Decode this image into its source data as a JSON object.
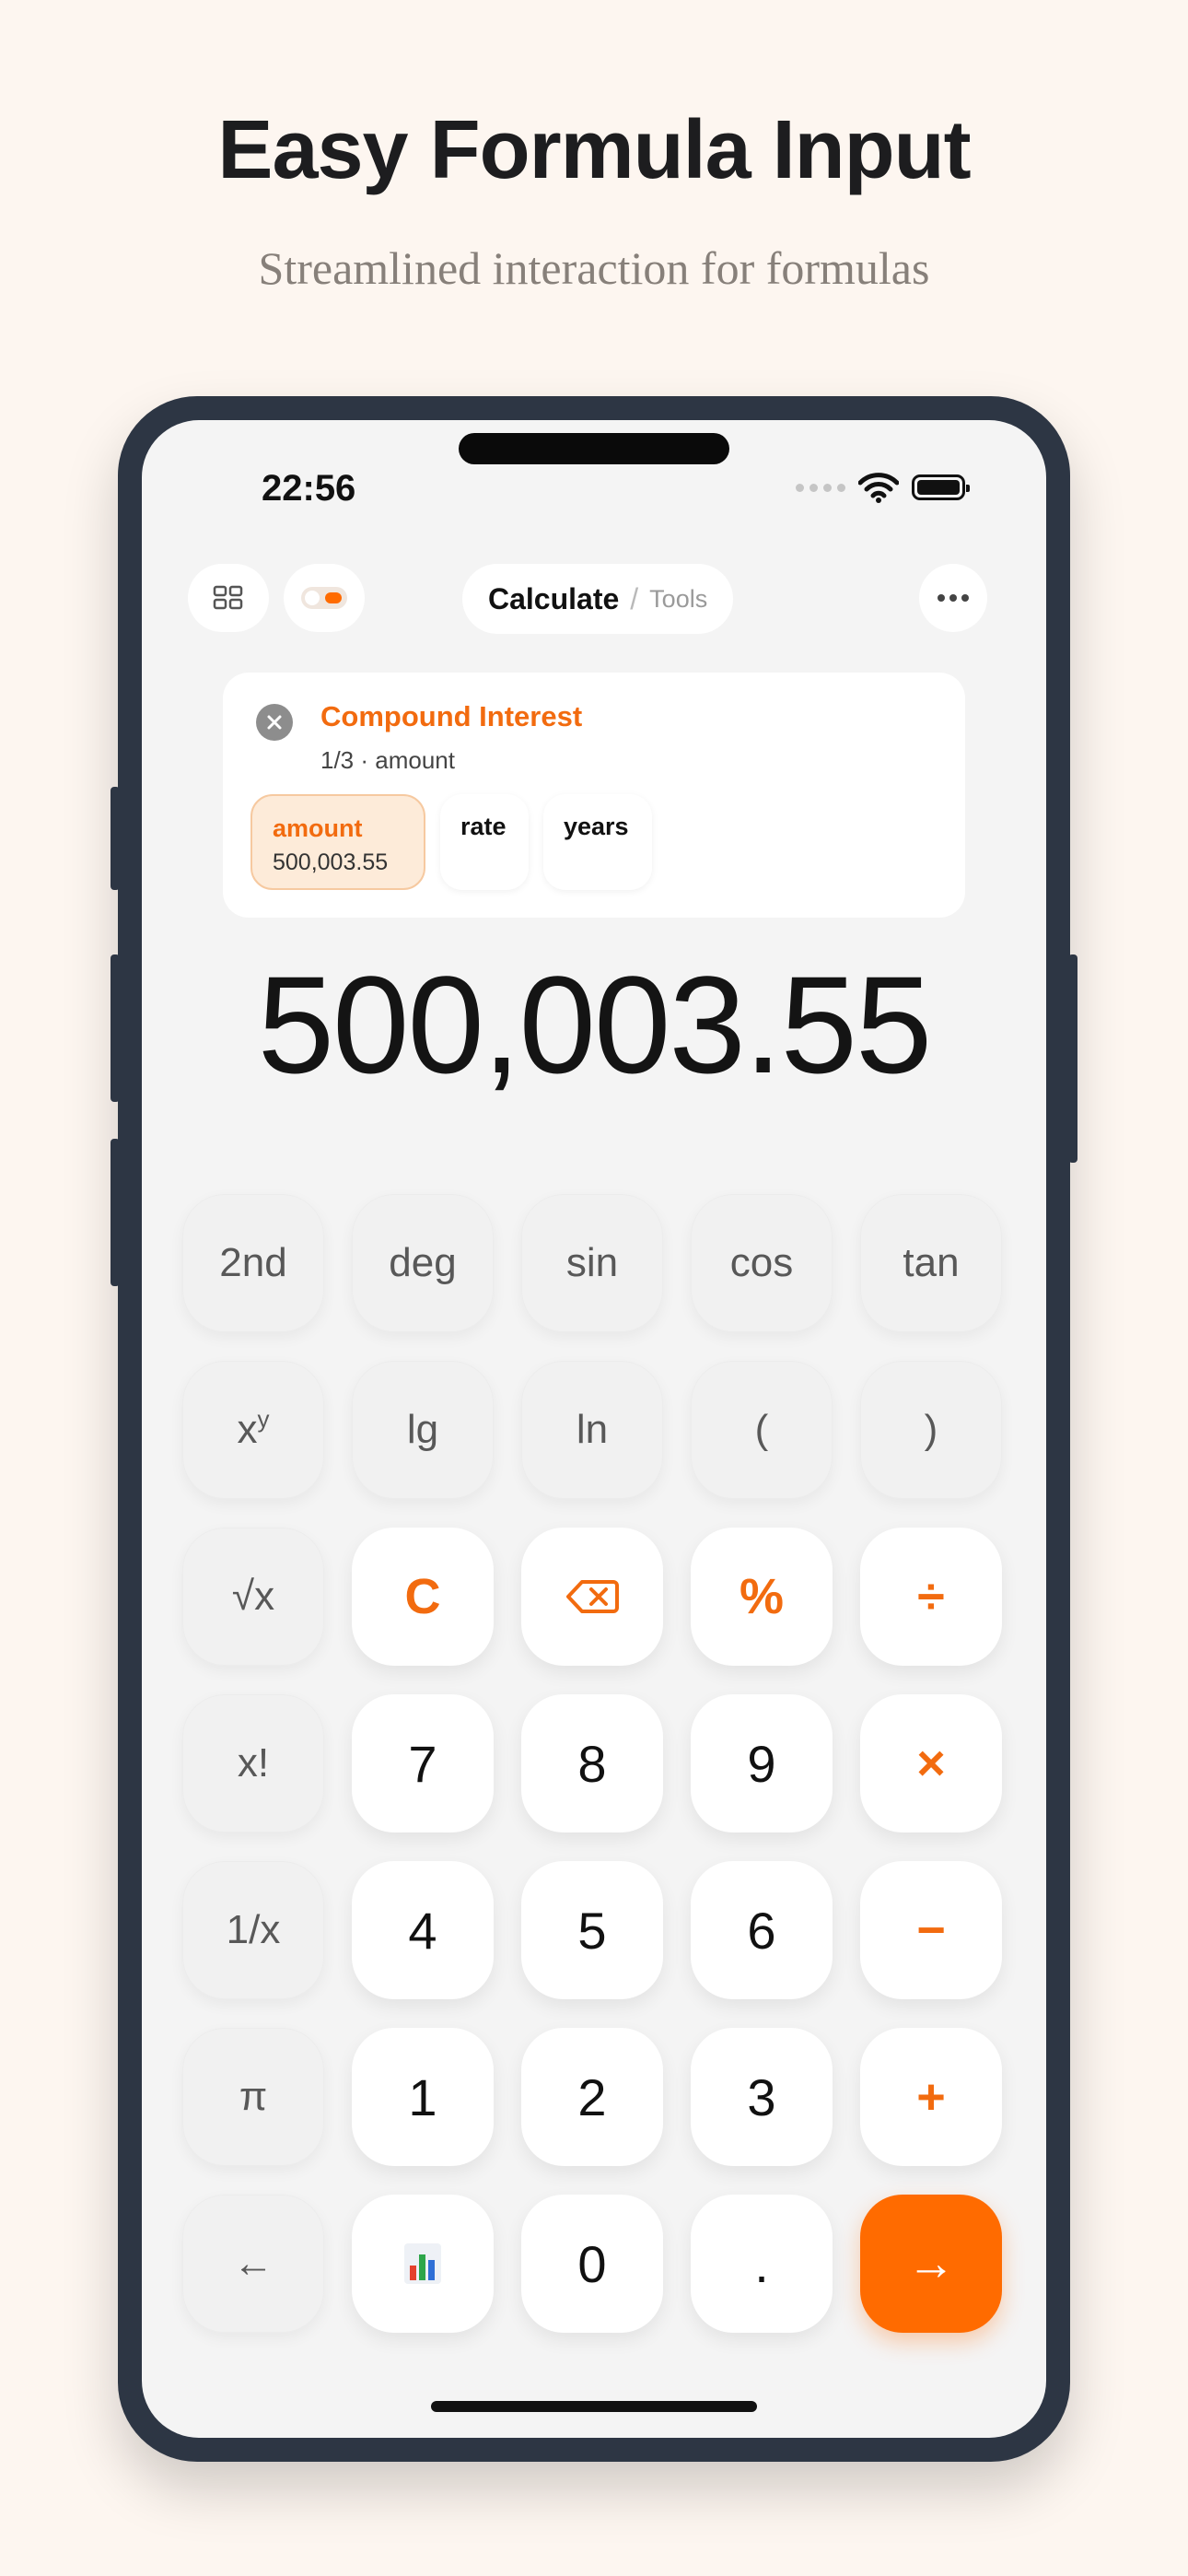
{
  "headline": "Easy Formula Input",
  "subheadline": "Streamlined interaction for formulas",
  "status_bar": {
    "time": "22:56"
  },
  "toolbar": {
    "title": "Calculate",
    "separator": "/",
    "subtitle": "Tools",
    "icons": [
      "grid-icon",
      "toggle-icon",
      "more-icon"
    ]
  },
  "formula": {
    "title": "Compound Interest",
    "progress": "1/3 · amount",
    "params": [
      {
        "name": "amount",
        "value": "500,003.55",
        "active": true
      },
      {
        "name": "rate",
        "value": "",
        "active": false
      },
      {
        "name": "years",
        "value": "",
        "active": false
      }
    ]
  },
  "display": {
    "value": "500,003.55"
  },
  "keys": {
    "second": "2nd",
    "deg": "deg",
    "sin": "sin",
    "cos": "cos",
    "tan": "tan",
    "pow_base": "x",
    "pow_exp": "y",
    "lg": "lg",
    "ln": "ln",
    "lparen": "(",
    "rparen": ")",
    "sqrt": "√x",
    "clear": "C",
    "percent": "%",
    "divide": "÷",
    "fact": "x!",
    "n7": "7",
    "n8": "8",
    "n9": "9",
    "multiply": "×",
    "inv": "1/x",
    "n4": "4",
    "n5": "5",
    "n6": "6",
    "minus": "−",
    "pi": "π",
    "n1": "1",
    "n2": "2",
    "n3": "3",
    "plus": "+",
    "back": "←",
    "n0": "0",
    "dot": ".",
    "next": "→"
  },
  "colors": {
    "accent": "#ff6b00",
    "accent_text": "#f26b0f",
    "background": "#fdf6f0",
    "frame": "#2d3644"
  }
}
